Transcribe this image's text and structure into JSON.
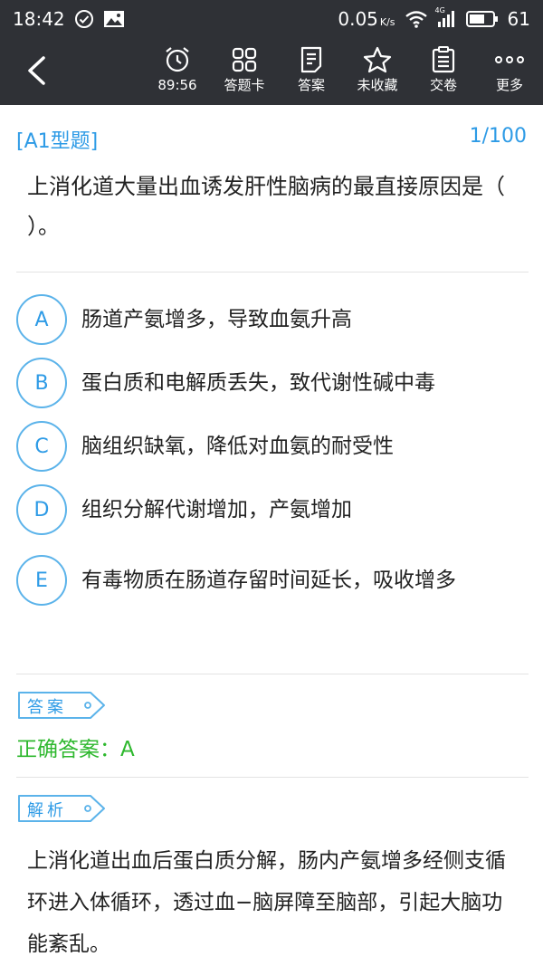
{
  "status_bar": {
    "time": "18:42",
    "net_speed": "0.05",
    "net_unit": "K/s",
    "signal_label": "4G",
    "battery": "61"
  },
  "toolbar": {
    "timer": "89:56",
    "answer_card": "答题卡",
    "answer": "答案",
    "favorite": "未收藏",
    "submit": "交卷",
    "more": "更多"
  },
  "question": {
    "type": "[A1型题]",
    "progress": "1/100",
    "text": "上消化道大量出血诱发肝性脑病的最直接原因是（ ）。"
  },
  "options": [
    {
      "letter": "A",
      "text": "肠道产氨增多，导致血氨升高"
    },
    {
      "letter": "B",
      "text": "蛋白质和电解质丢失，致代谢性碱中毒"
    },
    {
      "letter": "C",
      "text": "脑组织缺氧，降低对血氨的耐受性"
    },
    {
      "letter": "D",
      "text": "组织分解代谢增加，产氨增加"
    },
    {
      "letter": "E",
      "text": "有毒物质在肠道存留时间延长，吸收增多"
    }
  ],
  "answer_section": {
    "tag": "答案",
    "correct": "正确答案：A"
  },
  "analysis_section": {
    "tag": "解析",
    "text": "上消化道出血后蛋白质分解，肠内产氨增多经侧支循环进入体循环，透过血−脑屏障至脑部，引起大脑功能紊乱。"
  },
  "colors": {
    "bar_bg": "#2f3136",
    "accent_blue": "#2e9be6",
    "correct_green": "#2eb82e"
  }
}
